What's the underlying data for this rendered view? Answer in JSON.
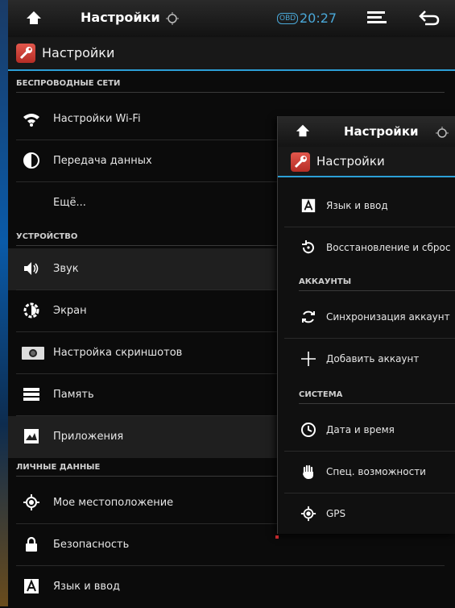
{
  "statusbar": {
    "title": "Настройки",
    "obd": "OBD",
    "time": "20:27"
  },
  "actionbar": {
    "title": "Настройки"
  },
  "sections": {
    "wireless": "БЕСПРОВОДНЫЕ СЕТИ",
    "device": "УСТРОЙСТВО",
    "personal": "ЛИЧНЫЕ ДАННЫЕ"
  },
  "items": {
    "wifi": "Настройки Wi-Fi",
    "data": "Передача данных",
    "more": "Ещё...",
    "sound": "Звук",
    "screen": "Экран",
    "screenshots": "Настройка скриншотов",
    "memory": "Память",
    "apps": "Приложения",
    "location": "Мое местоположение",
    "security": "Безопасность",
    "language": "Язык и ввод"
  },
  "overlay": {
    "status_title": "Настройки",
    "action_title": "Настройки",
    "items": {
      "language": "Язык и ввод",
      "reset": "Восстановление и сброс",
      "sync": "Синхронизация аккаунт",
      "add_account": "Добавить аккаунт",
      "datetime": "Дата и время",
      "accessibility": "Спец. возможности",
      "gps": "GPS"
    },
    "sections": {
      "accounts": "АККАУНТЫ",
      "system": "СИСТЕМА"
    }
  },
  "colors": {
    "accent": "#2c9fd6",
    "clock": "#4aa8d8",
    "app_icon": "#d9453b"
  }
}
